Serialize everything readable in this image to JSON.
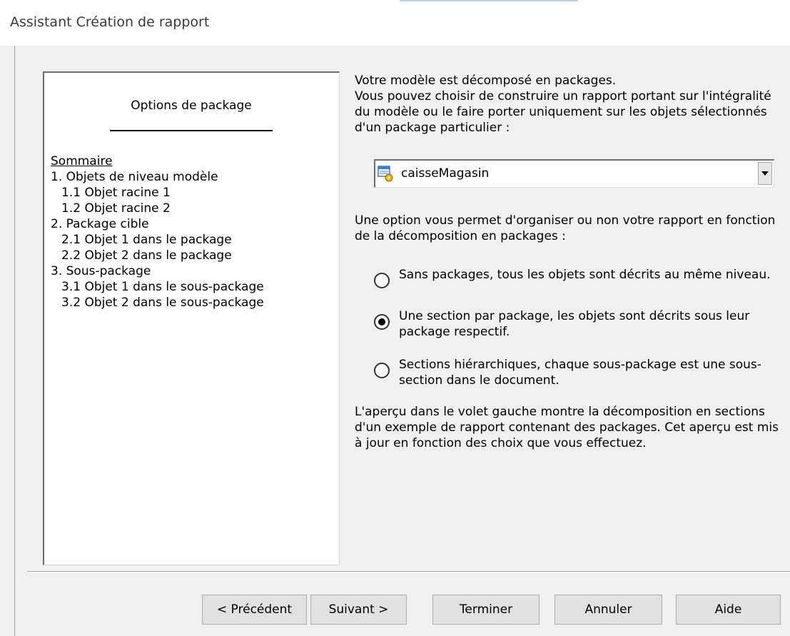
{
  "window": {
    "title": "Assistant Création de rapport"
  },
  "preview": {
    "heading": "Options de package",
    "toc": [
      {
        "text": "Sommaire",
        "type": "head"
      },
      {
        "text": "1. Objets de niveau modèle",
        "type": "level1"
      },
      {
        "text": "1.1 Objet racine 1",
        "type": "level2"
      },
      {
        "text": "1.2 Objet racine 2",
        "type": "level2"
      },
      {
        "text": "2. Package cible",
        "type": "level1"
      },
      {
        "text": "2.1 Objet 1 dans le package",
        "type": "level2"
      },
      {
        "text": "2.2 Objet 2 dans le package",
        "type": "level2"
      },
      {
        "text": "3. Sous-package",
        "type": "level1"
      },
      {
        "text": "3.1 Objet 1 dans le sous-package",
        "type": "level2"
      },
      {
        "text": "3.2 Objet 2 dans le sous-package",
        "type": "level2"
      }
    ]
  },
  "intro": {
    "line1": "Votre modèle est décomposé en packages.",
    "line2": "Vous pouvez choisir de construire un rapport portant sur l'intégralité du modèle ou le faire porter uniquement sur les objets sélectionnés d'un package particulier :"
  },
  "package_select": {
    "value": "caisseMagasin",
    "icon": "package-icon"
  },
  "options": {
    "description": "Une option vous permet d'organiser ou non votre rapport en fonction de la décomposition en packages :",
    "radios": [
      {
        "label": "Sans packages, tous les objets sont décrits au même niveau.",
        "selected": false
      },
      {
        "label": "Une section par package, les objets sont décrits sous leur package respectif.",
        "selected": true
      },
      {
        "label": "Sections hiérarchiques, chaque sous-package est une sous-section dans le document.",
        "selected": false
      }
    ]
  },
  "preview_note": "L'aperçu dans le volet gauche montre la décomposition en sections d'un exemple de rapport contenant des packages. Cet aperçu est mis à jour en fonction des choix que vous effectuez.",
  "buttons": {
    "previous": "< Précédent",
    "next": "Suivant >",
    "finish": "Terminer",
    "cancel": "Annuler",
    "help": "Aide"
  }
}
